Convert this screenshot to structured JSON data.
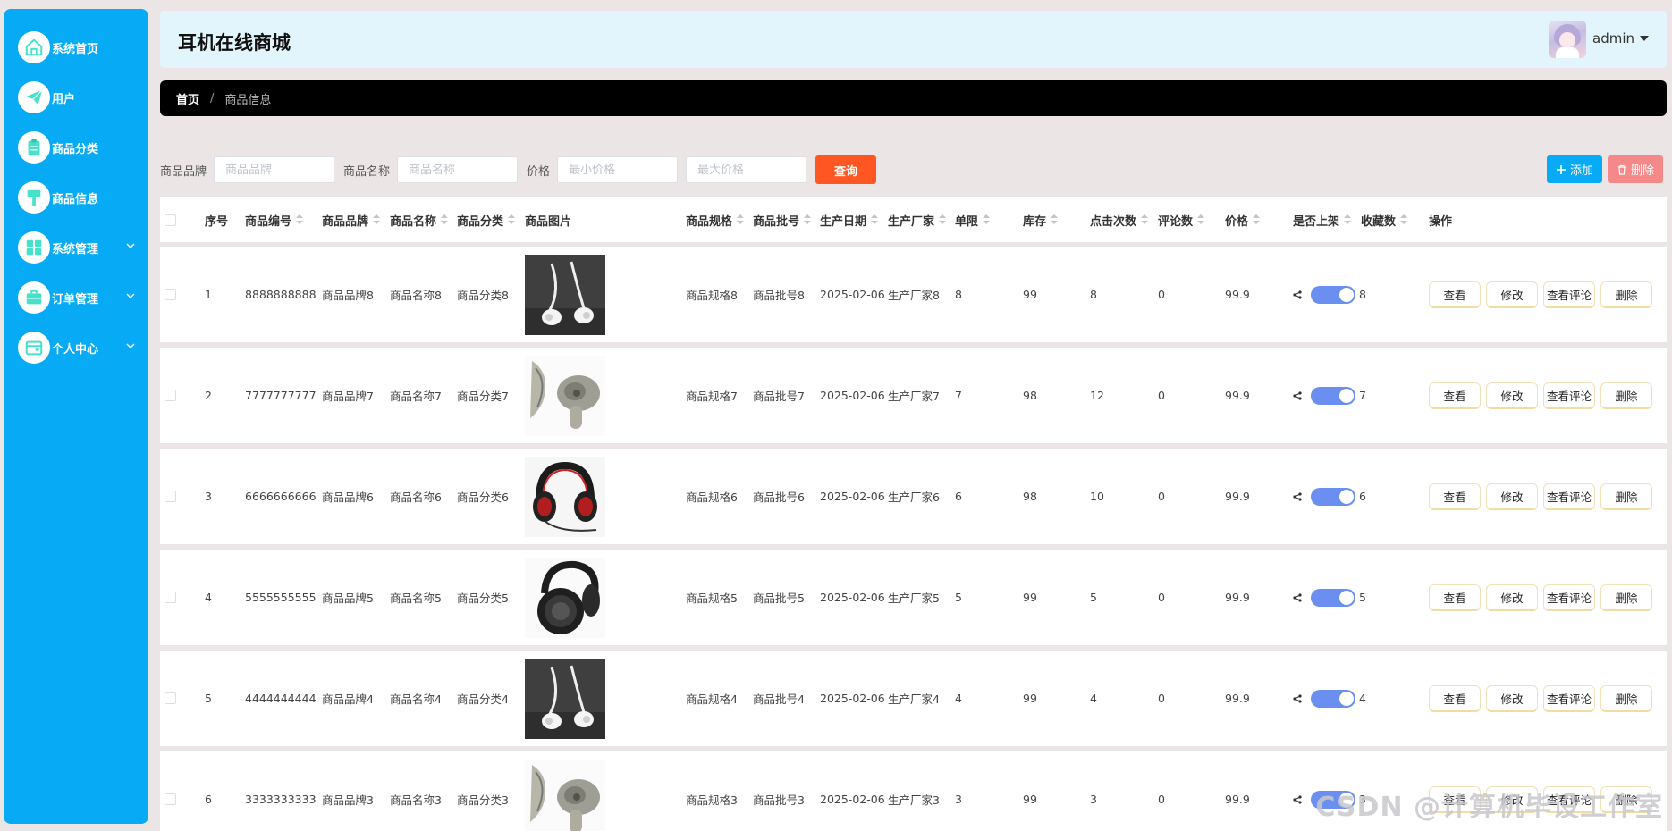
{
  "sidebar": {
    "items": [
      {
        "label": "系统首页",
        "icon": "home-icon"
      },
      {
        "label": "用户",
        "icon": "paper-plane-icon"
      },
      {
        "label": "商品分类",
        "icon": "clipboard-icon"
      },
      {
        "label": "商品信息",
        "icon": "paint-roller-icon"
      },
      {
        "label": "系统管理",
        "icon": "grid-icon",
        "expandable": true
      },
      {
        "label": "订单管理",
        "icon": "briefcase-icon",
        "expandable": true
      },
      {
        "label": "个人中心",
        "icon": "wallet-icon",
        "expandable": true
      }
    ],
    "color": "#06aaf5",
    "icon_color": "#45e1c9"
  },
  "header": {
    "title": "耳机在线商城",
    "username": "admin"
  },
  "breadcrumb": {
    "home": "首页",
    "separator": "/",
    "current": "商品信息"
  },
  "filters": {
    "brand_label": "商品品牌",
    "brand_placeholder": "商品品牌",
    "name_label": "商品名称",
    "name_placeholder": "商品名称",
    "price_label": "价格",
    "min_price_placeholder": "最小价格",
    "max_price_placeholder": "最大价格",
    "query_label": "查询"
  },
  "toolbar": {
    "add_label": "添加",
    "delete_label": "删除"
  },
  "table": {
    "headers": {
      "index": "序号",
      "code": "商品编号",
      "brand": "商品品牌",
      "name": "商品名称",
      "category": "商品分类",
      "image": "商品图片",
      "spec": "商品规格",
      "batch": "商品批号",
      "date": "生产日期",
      "maker": "生产厂家",
      "limit": "单限",
      "stock": "库存",
      "clicks": "点击次数",
      "comments": "评论数",
      "price": "价格",
      "listed": "是否上架",
      "favorites": "收藏数",
      "actions": "操作"
    },
    "action_labels": {
      "view": "查看",
      "edit": "修改",
      "view_comments": "查看评论",
      "delete": "删除"
    },
    "rows": [
      {
        "index": "1",
        "code": "8888888888",
        "brand": "商品品牌8",
        "name": "商品名称8",
        "category": "商品分类8",
        "image": "white-earbuds",
        "spec": "商品规格8",
        "batch": "商品批号8",
        "date": "2025-02-06",
        "maker": "生产厂家8",
        "limit": "8",
        "stock": "99",
        "clicks": "8",
        "comments": "0",
        "price": "99.9",
        "listed": true,
        "favorites": "8"
      },
      {
        "index": "2",
        "code": "7777777777",
        "brand": "商品品牌7",
        "name": "商品名称7",
        "category": "商品分类7",
        "image": "gray-wireless-earbuds",
        "spec": "商品规格7",
        "batch": "商品批号7",
        "date": "2025-02-06",
        "maker": "生产厂家7",
        "limit": "7",
        "stock": "98",
        "clicks": "12",
        "comments": "0",
        "price": "99.9",
        "listed": true,
        "favorites": "7"
      },
      {
        "index": "3",
        "code": "6666666666",
        "brand": "商品品牌6",
        "name": "商品名称6",
        "category": "商品分类6",
        "image": "red-black-headset",
        "spec": "商品规格6",
        "batch": "商品批号6",
        "date": "2025-02-06",
        "maker": "生产厂家6",
        "limit": "6",
        "stock": "98",
        "clicks": "10",
        "comments": "0",
        "price": "99.9",
        "listed": true,
        "favorites": "6"
      },
      {
        "index": "4",
        "code": "5555555555",
        "brand": "商品品牌5",
        "name": "商品名称5",
        "category": "商品分类5",
        "image": "black-headphones",
        "spec": "商品规格5",
        "batch": "商品批号5",
        "date": "2025-02-06",
        "maker": "生产厂家5",
        "limit": "5",
        "stock": "99",
        "clicks": "5",
        "comments": "0",
        "price": "99.9",
        "listed": true,
        "favorites": "5"
      },
      {
        "index": "5",
        "code": "4444444444",
        "brand": "商品品牌4",
        "name": "商品名称4",
        "category": "商品分类4",
        "image": "white-earbuds",
        "spec": "商品规格4",
        "batch": "商品批号4",
        "date": "2025-02-06",
        "maker": "生产厂家4",
        "limit": "4",
        "stock": "99",
        "clicks": "4",
        "comments": "0",
        "price": "99.9",
        "listed": true,
        "favorites": "4"
      },
      {
        "index": "6",
        "code": "3333333333",
        "brand": "商品品牌3",
        "name": "商品名称3",
        "category": "商品分类3",
        "image": "gray-wireless-earbuds",
        "spec": "商品规格3",
        "batch": "商品批号3",
        "date": "2025-02-06",
        "maker": "生产厂家3",
        "limit": "3",
        "stock": "99",
        "clicks": "3",
        "comments": "0",
        "price": "99.9",
        "listed": true,
        "favorites": "3"
      }
    ]
  },
  "watermark": "CSDN @计算机毕设工作室",
  "colors": {
    "accent": "#06aaf5",
    "query": "#ff5622",
    "delete": "#f58989",
    "toggle": "#6a8ff0",
    "breadcrumb_bg": "#000000",
    "header_bg": "#e2f5fd"
  }
}
